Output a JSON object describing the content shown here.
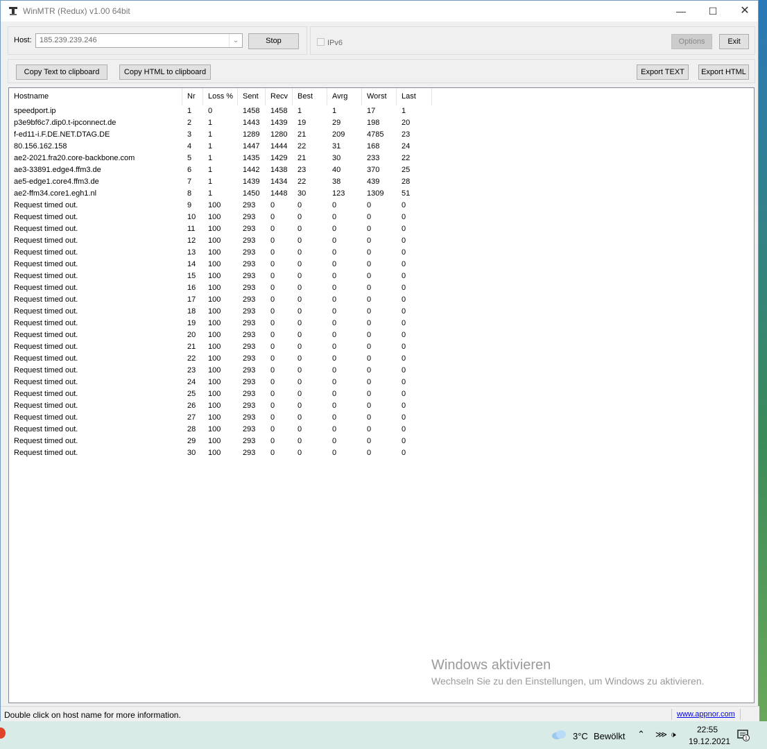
{
  "window": {
    "title": "WinMTR (Redux) v1.00 64bit",
    "minimize_icon": "minimize-icon",
    "maximize_icon": "maximize-icon",
    "close_icon": "close-icon"
  },
  "toolbar": {
    "host_label": "Host:",
    "host_value": "185.239.239.246",
    "stop_label": "Stop",
    "ipv6_label": "IPv6",
    "ipv6_checked": false,
    "options_label": "Options",
    "exit_label": "Exit"
  },
  "actions": {
    "copy_text_label": "Copy Text to clipboard",
    "copy_html_label": "Copy HTML to clipboard",
    "export_text_label": "Export TEXT",
    "export_html_label": "Export HTML"
  },
  "table": {
    "columns": [
      "Hostname",
      "Nr",
      "Loss %",
      "Sent",
      "Recv",
      "Best",
      "Avrg",
      "Worst",
      "Last"
    ],
    "rows": [
      [
        "speedport.ip",
        "1",
        "0",
        "1458",
        "1458",
        "1",
        "1",
        "17",
        "1"
      ],
      [
        "p3e9bf6c7.dip0.t-ipconnect.de",
        "2",
        "1",
        "1443",
        "1439",
        "19",
        "29",
        "198",
        "20"
      ],
      [
        "f-ed11-i.F.DE.NET.DTAG.DE",
        "3",
        "1",
        "1289",
        "1280",
        "21",
        "209",
        "4785",
        "23"
      ],
      [
        "80.156.162.158",
        "4",
        "1",
        "1447",
        "1444",
        "22",
        "31",
        "168",
        "24"
      ],
      [
        "ae2-2021.fra20.core-backbone.com",
        "5",
        "1",
        "1435",
        "1429",
        "21",
        "30",
        "233",
        "22"
      ],
      [
        "ae3-33891.edge4.ffm3.de",
        "6",
        "1",
        "1442",
        "1438",
        "23",
        "40",
        "370",
        "25"
      ],
      [
        "ae5-edge1.core4.ffm3.de",
        "7",
        "1",
        "1439",
        "1434",
        "22",
        "38",
        "439",
        "28"
      ],
      [
        "ae2-ffm34.core1.egh1.nl",
        "8",
        "1",
        "1450",
        "1448",
        "30",
        "123",
        "1309",
        "51"
      ],
      [
        "Request timed out.",
        "9",
        "100",
        "293",
        "0",
        "0",
        "0",
        "0",
        "0"
      ],
      [
        "Request timed out.",
        "10",
        "100",
        "293",
        "0",
        "0",
        "0",
        "0",
        "0"
      ],
      [
        "Request timed out.",
        "11",
        "100",
        "293",
        "0",
        "0",
        "0",
        "0",
        "0"
      ],
      [
        "Request timed out.",
        "12",
        "100",
        "293",
        "0",
        "0",
        "0",
        "0",
        "0"
      ],
      [
        "Request timed out.",
        "13",
        "100",
        "293",
        "0",
        "0",
        "0",
        "0",
        "0"
      ],
      [
        "Request timed out.",
        "14",
        "100",
        "293",
        "0",
        "0",
        "0",
        "0",
        "0"
      ],
      [
        "Request timed out.",
        "15",
        "100",
        "293",
        "0",
        "0",
        "0",
        "0",
        "0"
      ],
      [
        "Request timed out.",
        "16",
        "100",
        "293",
        "0",
        "0",
        "0",
        "0",
        "0"
      ],
      [
        "Request timed out.",
        "17",
        "100",
        "293",
        "0",
        "0",
        "0",
        "0",
        "0"
      ],
      [
        "Request timed out.",
        "18",
        "100",
        "293",
        "0",
        "0",
        "0",
        "0",
        "0"
      ],
      [
        "Request timed out.",
        "19",
        "100",
        "293",
        "0",
        "0",
        "0",
        "0",
        "0"
      ],
      [
        "Request timed out.",
        "20",
        "100",
        "293",
        "0",
        "0",
        "0",
        "0",
        "0"
      ],
      [
        "Request timed out.",
        "21",
        "100",
        "293",
        "0",
        "0",
        "0",
        "0",
        "0"
      ],
      [
        "Request timed out.",
        "22",
        "100",
        "293",
        "0",
        "0",
        "0",
        "0",
        "0"
      ],
      [
        "Request timed out.",
        "23",
        "100",
        "293",
        "0",
        "0",
        "0",
        "0",
        "0"
      ],
      [
        "Request timed out.",
        "24",
        "100",
        "293",
        "0",
        "0",
        "0",
        "0",
        "0"
      ],
      [
        "Request timed out.",
        "25",
        "100",
        "293",
        "0",
        "0",
        "0",
        "0",
        "0"
      ],
      [
        "Request timed out.",
        "26",
        "100",
        "293",
        "0",
        "0",
        "0",
        "0",
        "0"
      ],
      [
        "Request timed out.",
        "27",
        "100",
        "293",
        "0",
        "0",
        "0",
        "0",
        "0"
      ],
      [
        "Request timed out.",
        "28",
        "100",
        "293",
        "0",
        "0",
        "0",
        "0",
        "0"
      ],
      [
        "Request timed out.",
        "29",
        "100",
        "293",
        "0",
        "0",
        "0",
        "0",
        "0"
      ],
      [
        "Request timed out.",
        "30",
        "100",
        "293",
        "0",
        "0",
        "0",
        "0",
        "0"
      ]
    ]
  },
  "watermark": {
    "line1": "Windows aktivieren",
    "line2": "Wechseln Sie zu den Einstellungen, um Windows zu aktivieren."
  },
  "status": {
    "hint": "Double click on host name for more information.",
    "link": "www.appnor.com"
  },
  "taskbar": {
    "weather_icon": "cloud-icon",
    "temperature": "3°C",
    "weather": "Bewölkt",
    "time": "22:55",
    "date": "19.12.2021",
    "notification_count": "1"
  }
}
